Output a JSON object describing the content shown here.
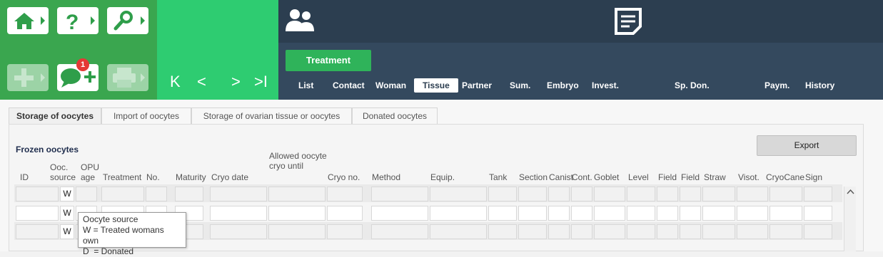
{
  "toolbar": {
    "notification_count": "1",
    "colors": {
      "primary_green": "#3aa64f",
      "nav_green": "#2ecc71",
      "dark_header": "#2c3e50",
      "badge_red": "#e53935"
    },
    "icons": [
      "home-icon",
      "help-icon",
      "search-icon",
      "add-icon",
      "chat-add-icon",
      "print-icon"
    ]
  },
  "navigation": {
    "first": "K",
    "prev": "<",
    "next": ">",
    "last": ">I"
  },
  "header": {
    "treatment_button": "Treatment",
    "tabs": [
      {
        "label": "List"
      },
      {
        "label": "Contact"
      },
      {
        "label": "Woman"
      },
      {
        "label": "Tissue"
      },
      {
        "label": "Partner"
      },
      {
        "label": "Sum."
      },
      {
        "label": "Embryo"
      },
      {
        "label": "Invest."
      },
      {
        "label": "Sp. Don."
      },
      {
        "label": "Paym."
      },
      {
        "label": "History"
      }
    ],
    "active_tab": "Tissue"
  },
  "subtabs": [
    {
      "label": "Storage of oocytes"
    },
    {
      "label": "Import of oocytes"
    },
    {
      "label": "Storage of ovarian tissue or oocytes"
    },
    {
      "label": "Donated oocytes"
    }
  ],
  "section_title": "Frozen oocytes",
  "export_label": "Export",
  "columns": [
    {
      "label": "ID"
    },
    {
      "label": "Ooc. source"
    },
    {
      "label": "OPU age"
    },
    {
      "label": "Treatment"
    },
    {
      "label": "No."
    },
    {
      "label": "Maturity"
    },
    {
      "label": "Cryo date"
    },
    {
      "label": "Allowed oocyte cryo until"
    },
    {
      "label": "Cryo no."
    },
    {
      "label": "Method"
    },
    {
      "label": "Equip."
    },
    {
      "label": "Tank"
    },
    {
      "label": "Section"
    },
    {
      "label": "Canist"
    },
    {
      "label": "Cont."
    },
    {
      "label": "Goblet"
    },
    {
      "label": "Level"
    },
    {
      "label": "Field"
    },
    {
      "label": "Field"
    },
    {
      "label": "Straw"
    },
    {
      "label": "Visot."
    },
    {
      "label": "CryoCane"
    },
    {
      "label": "Sign"
    }
  ],
  "rows": [
    {
      "ooc_source": "W"
    },
    {
      "ooc_source": "W"
    },
    {
      "ooc_source": "W"
    }
  ],
  "tooltip": {
    "title": "Oocyte source",
    "line1": "W = Treated womans own",
    "line2": "D  = Donated"
  }
}
